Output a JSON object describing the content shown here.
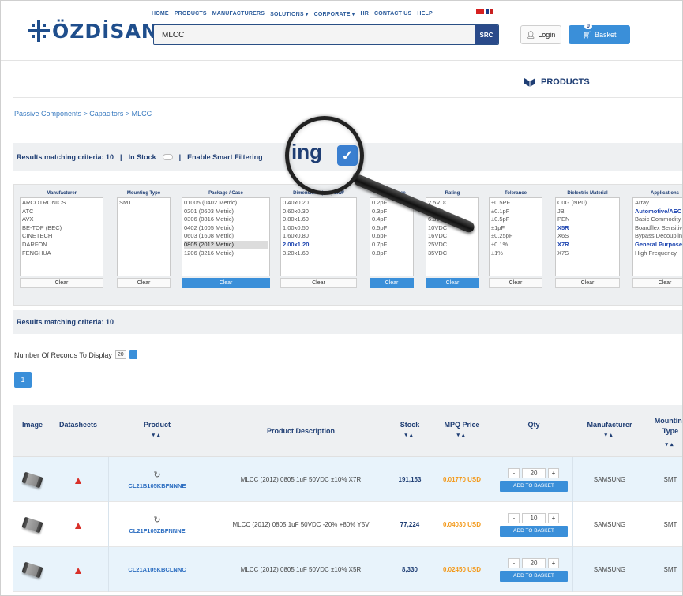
{
  "brand": {
    "logo_text": "ÖZDİSAN"
  },
  "nav": [
    "HOME",
    "PRODUCTS",
    "MANUFACTURERS",
    "SOLUTIONS ▾",
    "CORPORATE ▾",
    "HR",
    "CONTACT US",
    "HELP"
  ],
  "search": {
    "value": "MLCC",
    "button": "SRC"
  },
  "header": {
    "login": "Login",
    "basket": "Basket",
    "basket_count": "0"
  },
  "section_title": "PRODUCTS",
  "breadcrumb": "Passive Components > Capacitors > MLCC",
  "criteria_bar": {
    "results": "Results matching criteria: 10",
    "sep1": "|",
    "in_stock": "In Stock",
    "sep2": "|",
    "smart": "Enable Smart Filtering",
    "magnified_text": "ing"
  },
  "filters": [
    {
      "title": "Manufacturer",
      "items": [
        "ARCOTRONICS",
        "ATC",
        "AVX",
        "BE-TOP (BEC)",
        "CINETECH",
        "DARFON",
        "FENGHUA"
      ],
      "clear": "Clear",
      "active": false,
      "selected": [],
      "highlight": []
    },
    {
      "title": "Mounting Type",
      "items": [
        "SMT"
      ],
      "clear": "Clear",
      "active": false,
      "selected": [],
      "highlight": []
    },
    {
      "title": "Package / Case",
      "items": [
        "01005 (0402 Metric)",
        "0201 (0603 Metric)",
        "0306 (0816 Metric)",
        "0402 (1005 Metric)",
        "0603 (1608 Metric)",
        "0805 (2012 Metric)",
        "1206 (3216 Metric)"
      ],
      "clear": "Clear",
      "active": true,
      "selected": [
        5
      ],
      "highlight": []
    },
    {
      "title": "Dimensions (mm) LxW",
      "items": [
        "0.40x0.20",
        "0.60x0.30",
        "0.80x1.60",
        "1.00x0.50",
        "1.60x0.80",
        "2.00x1.20",
        "3.20x1.60"
      ],
      "clear": "Clear",
      "active": false,
      "selected": [],
      "highlight": [
        5
      ]
    },
    {
      "title": "Capacitance",
      "items": [
        "0.2pF",
        "0.3pF",
        "0.4pF",
        "0.5pF",
        "0.6pF",
        "0.7pF",
        "0.8pF"
      ],
      "clear": "Clear",
      "active": true,
      "selected": [],
      "highlight": []
    },
    {
      "title": "Rating",
      "items": [
        "2.5VDC",
        "4VDC",
        "6.3VDC",
        "10VDC",
        "16VDC",
        "25VDC",
        "35VDC"
      ],
      "clear": "Clear",
      "active": true,
      "selected": [],
      "highlight": []
    },
    {
      "title": "Tolerance",
      "items": [
        "±0.5PF",
        "±0.1pF",
        "±0.5pF",
        "±1pF",
        "±0.25pF",
        "±0.1%",
        "±1%"
      ],
      "clear": "Clear",
      "active": false,
      "selected": [],
      "highlight": []
    },
    {
      "title": "Dielectric Material",
      "items": [
        "C0G (NP0)",
        "JB",
        "PEN",
        "X5R",
        "X6S",
        "X7R",
        "X7S"
      ],
      "clear": "Clear",
      "active": false,
      "selected": [],
      "highlight": [
        3,
        5
      ]
    },
    {
      "title": "Applications",
      "items": [
        "Array",
        "Automotive/AEC",
        "Basic Commodity",
        "Boardflex Sensitive",
        "Bypass Decoupling",
        "General Purpose",
        "High Frequency"
      ],
      "clear": "Clear",
      "active": false,
      "selected": [],
      "highlight": [
        1,
        5
      ]
    }
  ],
  "results_bar": "Results matching criteria: 10",
  "records": {
    "label": "Number Of Records To Display",
    "value": "20"
  },
  "pagination": [
    "1"
  ],
  "table": {
    "headers": [
      "Image",
      "Datasheets",
      "Product",
      "Product Description",
      "Stock",
      "MPQ Price",
      "Qty",
      "Manufacturer",
      "Mounting Type"
    ],
    "sort_glyph": "▾▴",
    "add_label": "ADD TO BASKET",
    "minus": "-",
    "plus": "+",
    "rows": [
      {
        "product": "CL21B105KBFNNNE",
        "description": "MLCC (2012) 0805 1uF 50VDC ±10% X7R",
        "stock": "191,153",
        "price": "0.01770 USD",
        "qty": "20",
        "manufacturer": "SAMSUNG",
        "mounting": "SMT",
        "has_refresh": true
      },
      {
        "product": "CL21F105ZBFNNNE",
        "description": "MLCC (2012) 0805 1uF 50VDC -20% +80% Y5V",
        "stock": "77,224",
        "price": "0.04030 USD",
        "qty": "10",
        "manufacturer": "SAMSUNG",
        "mounting": "SMT",
        "has_refresh": true
      },
      {
        "product": "CL21A105KBCLNNC",
        "description": "MLCC (2012) 0805 1uF 50VDC ±10% X5R",
        "stock": "8,330",
        "price": "0.02450 USD",
        "qty": "20",
        "manufacturer": "SAMSUNG",
        "mounting": "SMT",
        "has_refresh": false
      }
    ]
  },
  "colors": {
    "brand": "#1f4e8c",
    "accent": "#3a8fd9",
    "price": "#f39a1c",
    "row_highlight": "#e8f3fb"
  }
}
